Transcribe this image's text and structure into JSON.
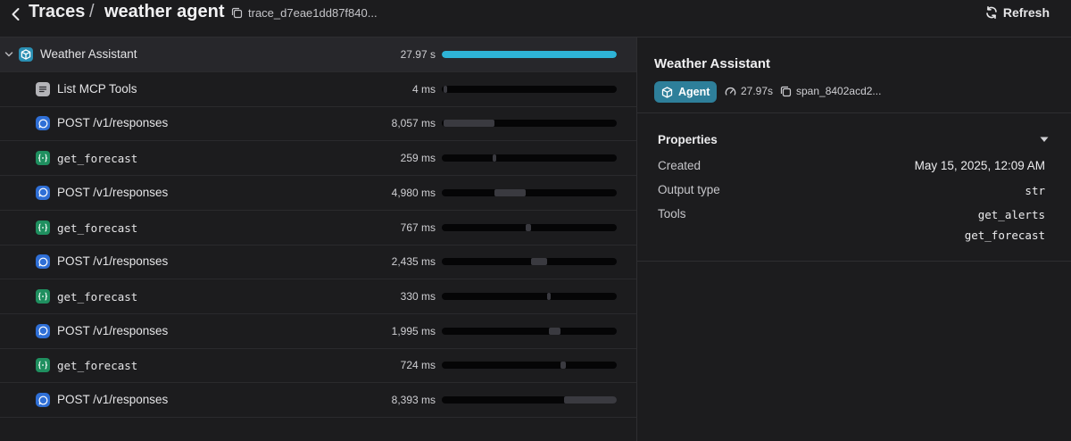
{
  "header": {
    "breadcrumb_root": "Traces",
    "separator": "/",
    "title": "weather agent",
    "trace_id": "trace_d7eae1dd87f840...",
    "refresh_label": "Refresh"
  },
  "spans": [
    {
      "label": "Weather Assistant",
      "duration": "27.97 s",
      "kind": "agent",
      "bar_start": 0.0,
      "bar_fraction": 1.0
    },
    {
      "label": "List MCP Tools",
      "duration": "4 ms",
      "kind": "list",
      "bar_start": 0.01,
      "bar_fraction": 0.02
    },
    {
      "label": "POST /v1/responses",
      "duration": "8,057 ms",
      "kind": "response",
      "bar_start": 0.01,
      "bar_fraction": 0.29
    },
    {
      "label": "get_forecast",
      "duration": "259 ms",
      "kind": "function",
      "bar_start": 0.29,
      "bar_fraction": 0.02
    },
    {
      "label": "POST /v1/responses",
      "duration": "4,980 ms",
      "kind": "response",
      "bar_start": 0.3,
      "bar_fraction": 0.18
    },
    {
      "label": "get_forecast",
      "duration": "767 ms",
      "kind": "function",
      "bar_start": 0.48,
      "bar_fraction": 0.03
    },
    {
      "label": "POST /v1/responses",
      "duration": "2,435 ms",
      "kind": "response",
      "bar_start": 0.51,
      "bar_fraction": 0.09
    },
    {
      "label": "get_forecast",
      "duration": "330 ms",
      "kind": "function",
      "bar_start": 0.6,
      "bar_fraction": 0.02
    },
    {
      "label": "POST /v1/responses",
      "duration": "1,995 ms",
      "kind": "response",
      "bar_start": 0.61,
      "bar_fraction": 0.07
    },
    {
      "label": "get_forecast",
      "duration": "724 ms",
      "kind": "function",
      "bar_start": 0.68,
      "bar_fraction": 0.03
    },
    {
      "label": "POST /v1/responses",
      "duration": "8,393 ms",
      "kind": "response",
      "bar_start": 0.7,
      "bar_fraction": 0.3
    }
  ],
  "detail": {
    "title": "Weather Assistant",
    "badge": "Agent",
    "duration": "27.97s",
    "span_id": "span_8402acd2...",
    "properties_title": "Properties",
    "properties": {
      "created_label": "Created",
      "created_value": "May 15, 2025, 12:09 AM",
      "output_type_label": "Output type",
      "output_type_value": "str",
      "tools_label": "Tools",
      "tools": [
        "get_alerts",
        "get_forecast"
      ]
    }
  },
  "colors": {
    "background": "#1c1c1e",
    "accent_bar": "#2eb3d6",
    "agent_badge": "#2e7f9a",
    "agent_icon": "#2a8fb3",
    "list_icon": "#b4b4b8",
    "response_icon": "#2f6fd6",
    "function_icon": "#1f8f5f"
  }
}
